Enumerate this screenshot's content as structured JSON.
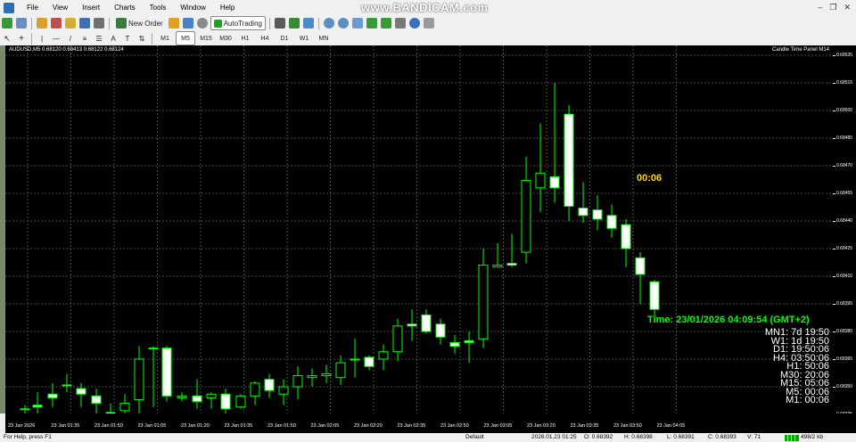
{
  "menu": {
    "items": [
      "File",
      "View",
      "Insert",
      "Charts",
      "Tools",
      "Window",
      "Help"
    ]
  },
  "watermark": "www.BANDICAM.com",
  "toolbar": {
    "new_order": "New Order",
    "autotrading": "AutoTrading",
    "timeframes": [
      "M1",
      "M5",
      "M15",
      "M30",
      "H1",
      "H4",
      "D1",
      "W1",
      "MN"
    ],
    "text_tool": "A",
    "label_tool": "T"
  },
  "chart": {
    "title": "AUDUSD,M5  0.68120 0.68413 0.68122 0.68124",
    "indicator": "Candle Time Panel M14",
    "timer": "00:06",
    "time_text": "Time: 23/01/2026 04:09:54 (GMT+2)",
    "timeframes": [
      "MN1: 7d 19:50",
      "W1: 1d 19:50",
      "D1: 19:50:06",
      "H4: 03:50:06",
      "H1: 50:06",
      "M30: 20:06",
      "M15: 05:06",
      "M5: 00:06",
      "M1: 00:06"
    ],
    "price_labels": [
      "0.68535",
      "0.68515",
      "0.68500",
      "0.68485",
      "0.68470",
      "0.68455",
      "0.68440",
      "0.68425",
      "0.68410",
      "0.68395",
      "0.68380",
      "0.68365",
      "0.68350",
      "0.68335"
    ],
    "time_labels": [
      "23 Jan 2026",
      "23 Jan 01:35",
      "23 Jan 01:50",
      "23 Jan 01:05",
      "23 Jan 01:20",
      "23 Jan 01:35",
      "23 Jan 01:50",
      "23 Jan 02:05",
      "23 Jan 02:20",
      "23 Jan 02:35",
      "23 Jan 02:50",
      "23 Jan 03:05",
      "23 Jan 03:20",
      "23 Jan 03:35",
      "23 Jan 03:50",
      "23 Jan 04:05"
    ],
    "colors": {
      "background": "#000000",
      "bull_candle": "#000000",
      "bear_candle": "#ffffff",
      "wick": "#00ff00",
      "grid": "#4a4a4a",
      "timer": "#ffd700",
      "time_text": "#00ff00"
    }
  },
  "status": {
    "help": "For Help, press F1",
    "profile": "Default",
    "datetime": "2026.01.23 01:25",
    "open": "O: 0.68392",
    "high": "H: 0.68398",
    "low": "L: 0.68391",
    "close": "C: 0.68393",
    "volume": "V: 71",
    "traffic": "498/2 kb"
  }
}
